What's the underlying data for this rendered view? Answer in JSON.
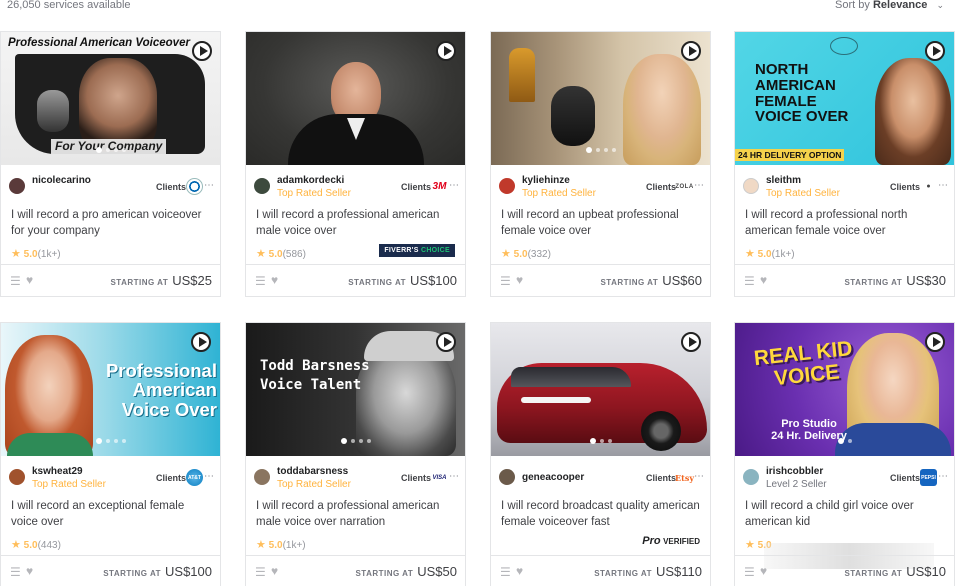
{
  "header": {
    "count_text": "26,050 services available",
    "sort_prefix": "Sort by",
    "sort_value": "Relevance"
  },
  "cards": [
    {
      "seller": "nicolecarino",
      "level": "",
      "clients": "Clients",
      "client_logo": "BMW",
      "title": "I will record a pro american voiceover for your company",
      "rating": "5.0",
      "reviews": "(1k+)",
      "price_label": "STARTING AT",
      "price": "US$25",
      "overlay": [
        "Professional American Voiceover",
        "For Your Company"
      ]
    },
    {
      "seller": "adamkordecki",
      "level": "Top Rated Seller",
      "clients": "Clients",
      "client_logo": "3M",
      "title": "I will record a professional american male voice over",
      "rating": "5.0",
      "reviews": "(586)",
      "badge": "FIVERR'S",
      "badge2": "CHOICE",
      "price_label": "STARTING AT",
      "price": "US$100"
    },
    {
      "seller": "kyliehinze",
      "level": "Top Rated Seller",
      "clients": "Clients",
      "client_logo": "ZOLA",
      "title": "I will record an upbeat professional female voice over",
      "rating": "5.0",
      "reviews": "(332)",
      "price_label": "STARTING AT",
      "price": "US$60"
    },
    {
      "seller": "sleithm",
      "level": "Top Rated Seller",
      "clients": "Clients",
      "client_logo": "●",
      "title": "I will record a professional north american female voice over",
      "rating": "5.0",
      "reviews": "(1k+)",
      "price_label": "STARTING AT",
      "price": "US$30",
      "overlay": [
        "NORTH",
        "AMERICAN",
        "FEMALE",
        "VOICE OVER",
        "24 HR DELIVERY OPTION"
      ]
    },
    {
      "seller": "kswheat29",
      "level": "Top Rated Seller",
      "clients": "Clients",
      "client_logo": "AT&T",
      "title": "I will record an exceptional female voice over",
      "rating": "5.0",
      "reviews": "(443)",
      "price_label": "STARTING AT",
      "price": "US$100",
      "overlay": [
        "Professional",
        "American",
        "Voice Over"
      ]
    },
    {
      "seller": "toddabarsness",
      "level": "Top Rated Seller",
      "clients": "Clients",
      "client_logo": "VISA",
      "title": "I will record a professional american male voice over narration",
      "rating": "5.0",
      "reviews": "(1k+)",
      "price_label": "STARTING AT",
      "price": "US$50",
      "overlay": [
        "Todd Barsness",
        "Voice Talent"
      ]
    },
    {
      "seller": "geneacooper",
      "level": "",
      "clients": "Clients",
      "client_logo": "Etsy",
      "title": "I will record broadcast quality american female voiceover fast",
      "rating": "",
      "reviews": "",
      "pro": "Pro",
      "pro_label": "VERIFIED",
      "price_label": "STARTING AT",
      "price": "US$110"
    },
    {
      "seller": "irishcobbler",
      "level": "Level 2 Seller",
      "clients": "Clients",
      "client_logo": "PEPSI",
      "title": "I will record a child girl voice over american kid",
      "rating": "5.0",
      "reviews": "",
      "price_label": "STARTING AT",
      "price": "US$10",
      "overlay": [
        "REAL KID",
        "VOICE",
        "Pro Studio",
        "24 Hr. Delivery"
      ]
    }
  ],
  "colors": {
    "accent": "#1dbf73",
    "star": "#ffbe5b",
    "top_rated": "#ffb33e"
  }
}
